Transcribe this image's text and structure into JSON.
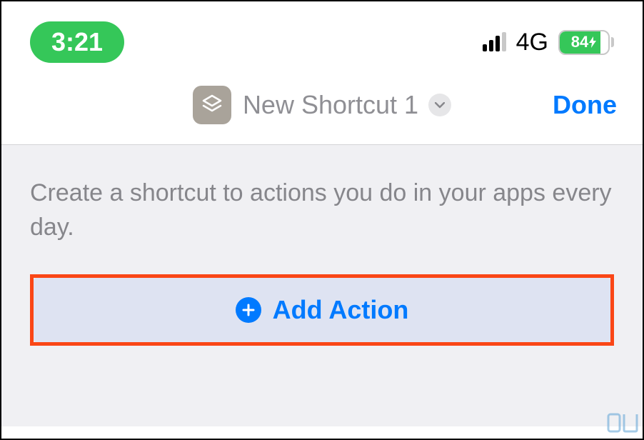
{
  "status_bar": {
    "time": "3:21",
    "network_type": "4G",
    "battery_percent": "84"
  },
  "header": {
    "shortcut_name": "New Shortcut 1",
    "done_label": "Done"
  },
  "content": {
    "instruction": "Create a shortcut to actions you do in your apps every day.",
    "add_action_label": "Add Action"
  },
  "colors": {
    "accent": "#007aff",
    "green": "#35c759",
    "highlight_border": "#fa4616"
  }
}
